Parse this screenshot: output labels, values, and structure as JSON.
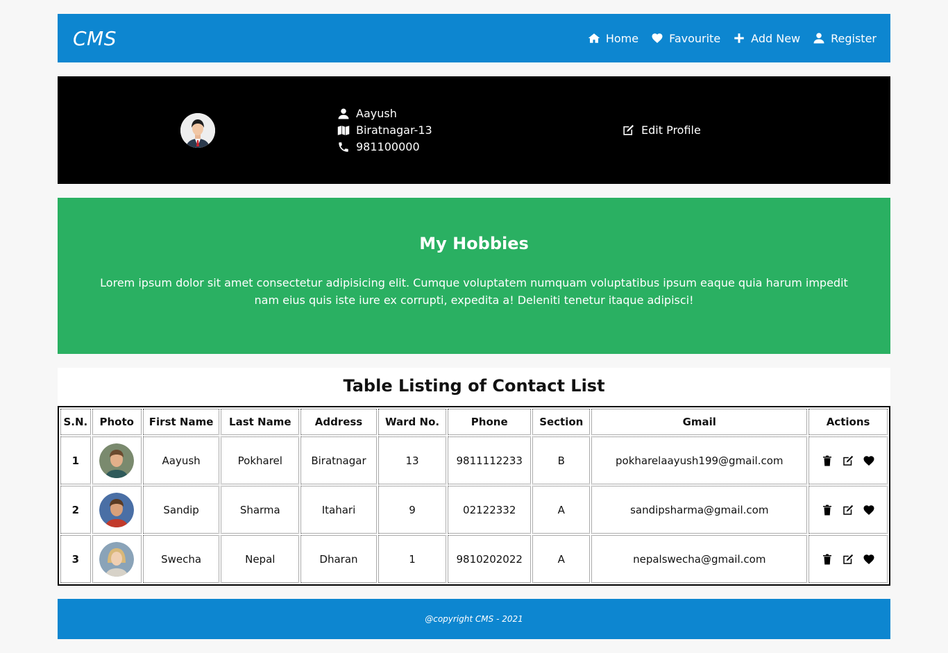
{
  "nav": {
    "brand": "CMS",
    "links": [
      {
        "label": "Home",
        "icon": "home-icon"
      },
      {
        "label": "Favourite",
        "icon": "heart-icon"
      },
      {
        "label": "Add New",
        "icon": "plus-icon"
      },
      {
        "label": "Register",
        "icon": "user-icon"
      }
    ]
  },
  "profile": {
    "name": "Aayush",
    "address": "Biratnagar-13",
    "phone": "981100000",
    "edit_label": "Edit Profile"
  },
  "hobbies": {
    "title": "My Hobbies",
    "text": "Lorem ipsum dolor sit amet consectetur adipisicing elit. Cumque voluptatem numquam voluptatibus ipsum eaque quia harum impedit nam eius quis iste iure ex corrupti, expedita a! Deleniti tenetur itaque adipisci!"
  },
  "table": {
    "title": "Table Listing of Contact List",
    "headers": [
      "S.N.",
      "Photo",
      "First Name",
      "Last Name",
      "Address",
      "Ward No.",
      "Phone",
      "Section",
      "Gmail",
      "Actions"
    ],
    "rows": [
      {
        "sn": "1",
        "first": "Aayush",
        "last": "Pokharel",
        "address": "Biratnagar",
        "ward": "13",
        "phone": "9811112233",
        "section": "B",
        "gmail": "pokharelaayush199@gmail.com"
      },
      {
        "sn": "2",
        "first": "Sandip",
        "last": "Sharma",
        "address": "Itahari",
        "ward": "9",
        "phone": "02122332",
        "section": "A",
        "gmail": "sandipsharma@gmail.com"
      },
      {
        "sn": "3",
        "first": "Swecha",
        "last": "Nepal",
        "address": "Dharan",
        "ward": "1",
        "phone": "9810202022",
        "section": "A",
        "gmail": "nepalswecha@gmail.com"
      }
    ]
  },
  "footer": {
    "text": "@copyright CMS - 2021"
  },
  "colors": {
    "primary": "#0d86d0",
    "hobbies": "#2ab062",
    "profile_bg": "#000000"
  }
}
